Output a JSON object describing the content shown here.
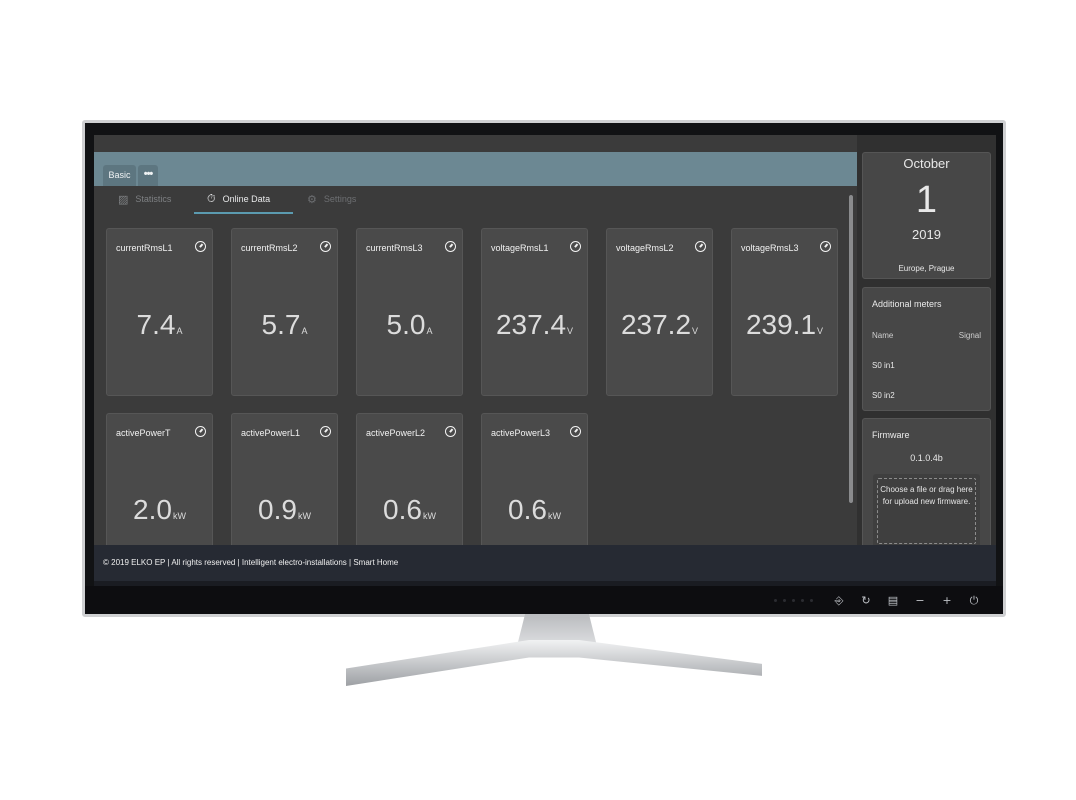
{
  "app": {
    "basic_tab": "Basic",
    "more_tab": "•••"
  },
  "tabs": [
    {
      "label": "Statistics",
      "icon": "chart-icon",
      "glyph": "▨",
      "active": false
    },
    {
      "label": "Online Data",
      "icon": "stopwatch-icon",
      "glyph": "⏱",
      "active": true
    },
    {
      "label": "Settings",
      "icon": "gear-icon",
      "glyph": "⚙",
      "active": false
    }
  ],
  "cards": [
    {
      "title": "currentRmsL1",
      "value": "7.4",
      "unit": "A"
    },
    {
      "title": "currentRmsL2",
      "value": "5.7",
      "unit": "A"
    },
    {
      "title": "currentRmsL3",
      "value": "5.0",
      "unit": "A"
    },
    {
      "title": "voltageRmsL1",
      "value": "237.4",
      "unit": "V"
    },
    {
      "title": "voltageRmsL2",
      "value": "237.2",
      "unit": "V"
    },
    {
      "title": "voltageRmsL3",
      "value": "239.1",
      "unit": "V"
    },
    {
      "title": "activePowerT",
      "value": "2.0",
      "unit": "kW"
    },
    {
      "title": "activePowerL1",
      "value": "0.9",
      "unit": "kW"
    },
    {
      "title": "activePowerL2",
      "value": "0.6",
      "unit": "kW"
    },
    {
      "title": "activePowerL3",
      "value": "0.6",
      "unit": "kW"
    }
  ],
  "date": {
    "month": "October",
    "day": "1",
    "year": "2019",
    "timezone": "Europe, Prague"
  },
  "meters": {
    "title": "Additional meters",
    "col_name": "Name",
    "col_signal": "Signal",
    "rows": [
      "S0 in1",
      "S0 in2"
    ]
  },
  "firmware": {
    "title": "Firmware",
    "version": "0.1.0.4b",
    "upload_text": "Choose a file or drag here for upload new firmware."
  },
  "footer": {
    "text": "© 2019 ELKO EP | All rights reserved | Intelligent electro-installations | Smart Home"
  },
  "hardware_buttons": [
    {
      "icon": "input-icon",
      "glyph": "⎆"
    },
    {
      "icon": "rotate-icon",
      "glyph": "↻"
    },
    {
      "icon": "menu-icon",
      "glyph": "▤"
    },
    {
      "icon": "minus-icon",
      "glyph": "−"
    },
    {
      "icon": "plus-icon",
      "glyph": "+"
    },
    {
      "icon": "power-icon",
      "glyph": "⏻"
    }
  ]
}
